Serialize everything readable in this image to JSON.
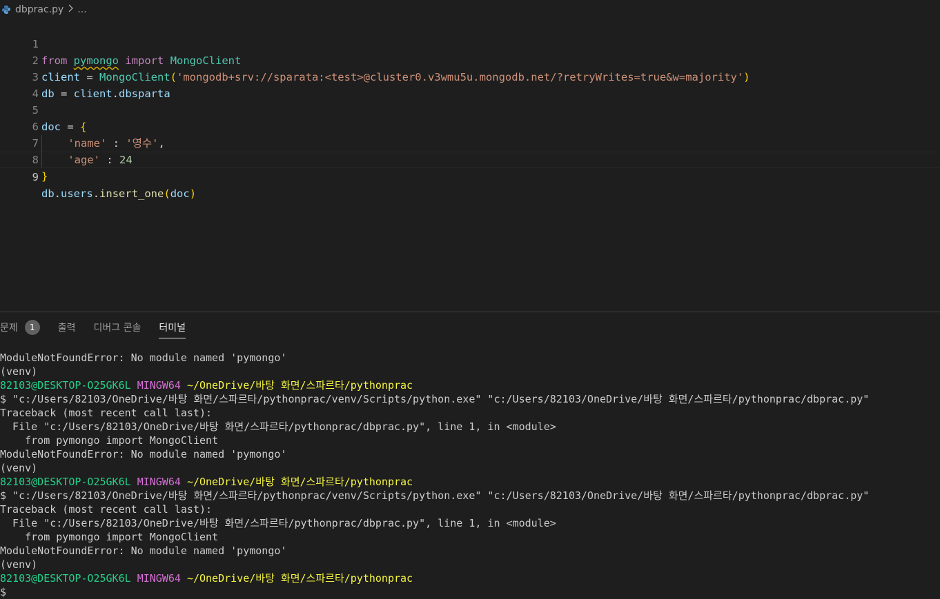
{
  "breadcrumb": {
    "file": "dbprac.py",
    "rest": "..."
  },
  "editor": {
    "lines": [
      {
        "n": "1"
      },
      {
        "n": "2"
      },
      {
        "n": "3"
      },
      {
        "n": "4"
      },
      {
        "n": "5"
      },
      {
        "n": "6"
      },
      {
        "n": "7"
      },
      {
        "n": "8"
      },
      {
        "n": "9"
      }
    ],
    "active_line": "9",
    "tokens": {
      "from": "from",
      "pymongo": "pymongo",
      "import": "import",
      "MongoClient": "MongoClient",
      "client": "client",
      "eq": " = ",
      "open_paren": "(",
      "close_paren": ")",
      "conn_str": "'mongodb+srv://sparata:<test>@cluster0.v3wmu5u.mongodb.net/?retryWrites=true&w=majority'",
      "db": "db",
      "dot": ".",
      "dbsparta": "dbsparta",
      "doc": "doc",
      "open_brace": "{",
      "close_brace": "}",
      "name_key": "'name'",
      "colon": " : ",
      "name_val": "'영수'",
      "comma": ",",
      "age_key": "'age'",
      "age_val": "24",
      "users": "users",
      "insert_one": "insert_one"
    }
  },
  "panel": {
    "tabs": [
      {
        "label": "문제",
        "badge": "1"
      },
      {
        "label": "출력"
      },
      {
        "label": "디버그 콘솔"
      },
      {
        "label": "터미널"
      }
    ],
    "active_tab": "터미널"
  },
  "terminal": {
    "err": "ModuleNotFoundError: No module named 'pymongo'",
    "venv": "(venv)",
    "user": "82103@DESKTOP-O25GK6L",
    "mingw": "MINGW64",
    "path": "~/OneDrive/바탕 화면/스파르타/pythonprac",
    "cmd": "$ \"c:/Users/82103/OneDrive/바탕 화면/스파르타/pythonprac/venv/Scripts/python.exe\" \"c:/Users/82103/OneDrive/바탕 화면/스파르타/pythonprac/dbprac.py\"",
    "traceback": "Traceback (most recent call last):",
    "file_line": "  File \"c:/Users/82103/OneDrive/바탕 화면/스파르타/pythonprac/dbprac.py\", line 1, in <module>",
    "from_line": "    from pymongo import MongoClient",
    "prompt": "$"
  },
  "colors": {
    "background": "#1e1e1e",
    "user": "#23d18b",
    "mingw": "#d670d6",
    "path": "#f5f543",
    "keyword": "#c586c0",
    "string": "#ce9178"
  }
}
